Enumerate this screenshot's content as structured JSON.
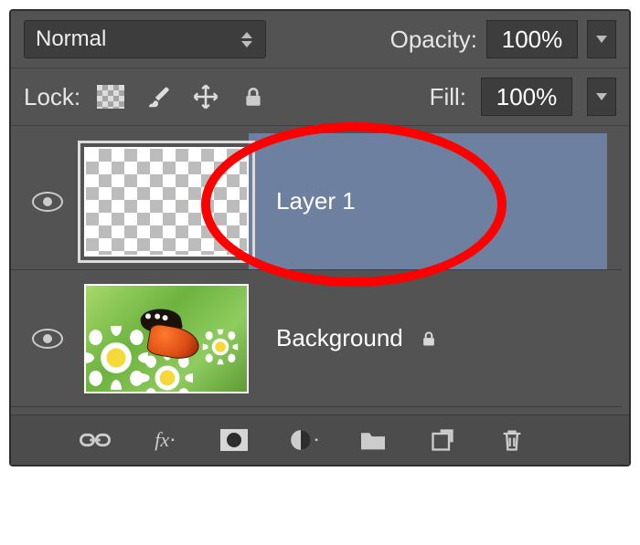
{
  "header": {
    "blend_mode": "Normal",
    "opacity_label": "Opacity:",
    "opacity_value": "100%"
  },
  "lockRow": {
    "lock_label": "Lock:",
    "fill_label": "Fill:",
    "fill_value": "100%"
  },
  "layers": [
    {
      "name": "Layer 1",
      "thumb": "transparent",
      "selected": true,
      "locked": false,
      "visible": true
    },
    {
      "name": "Background",
      "thumb": "image",
      "selected": false,
      "locked": true,
      "visible": true
    }
  ],
  "icons": {
    "checker": "transparency-lock-icon",
    "brush": "brush-icon",
    "move": "move-icon",
    "lock": "lock-icon"
  },
  "annotation": {
    "color": "#ff0000",
    "target": "Layer 1"
  }
}
